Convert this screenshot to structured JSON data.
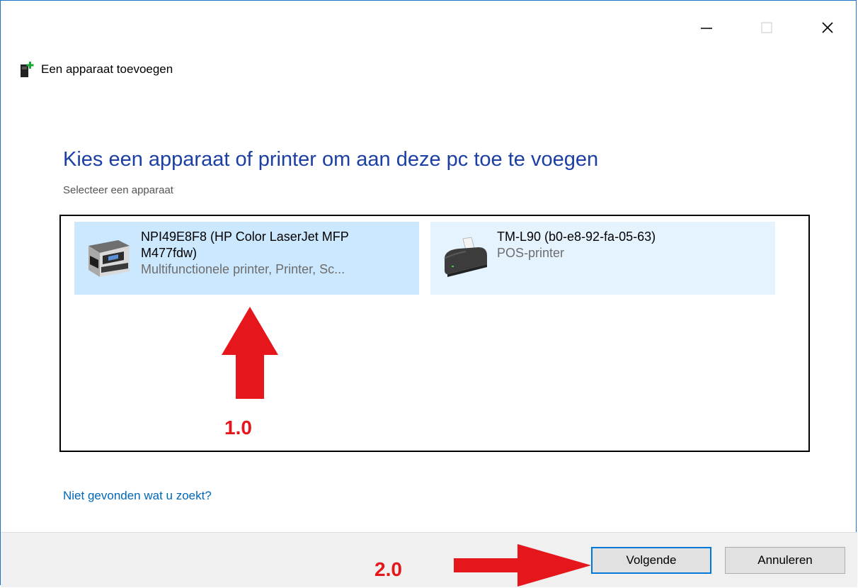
{
  "window": {
    "title": "Een apparaat toevoegen",
    "icon": "add-device-icon"
  },
  "titlebar": {
    "minimize_icon": "minimize-icon",
    "maximize_icon": "maximize-icon",
    "close_icon": "close-icon"
  },
  "main": {
    "heading": "Kies een apparaat of printer om aan deze pc toe te voegen",
    "subheading": "Selecteer een apparaat",
    "devices": [
      {
        "name_line1": "NPI49E8F8 (HP Color LaserJet MFP",
        "name_line2": "M477fdw)",
        "type": "Multifunctionele printer, Printer, Sc...",
        "icon": "multifunction-printer-icon",
        "selected": true
      },
      {
        "name_line1": "TM-L90 (b0-e8-92-fa-05-63)",
        "name_line2": "",
        "type": "POS-printer",
        "icon": "pos-printer-icon",
        "selected": false
      }
    ],
    "not_found_link": "Niet gevonden wat u zoekt?"
  },
  "footer": {
    "next_label": "Volgende",
    "cancel_label": "Annuleren"
  },
  "annotations": {
    "step1": "1.0",
    "step2": "2.0",
    "color": "#e5161c"
  },
  "colors": {
    "heading": "#1c3fa4",
    "link": "#0067b8",
    "selected_bg": "#cce8ff",
    "hover_bg": "#e5f3ff",
    "window_border": "#1e73c8"
  }
}
